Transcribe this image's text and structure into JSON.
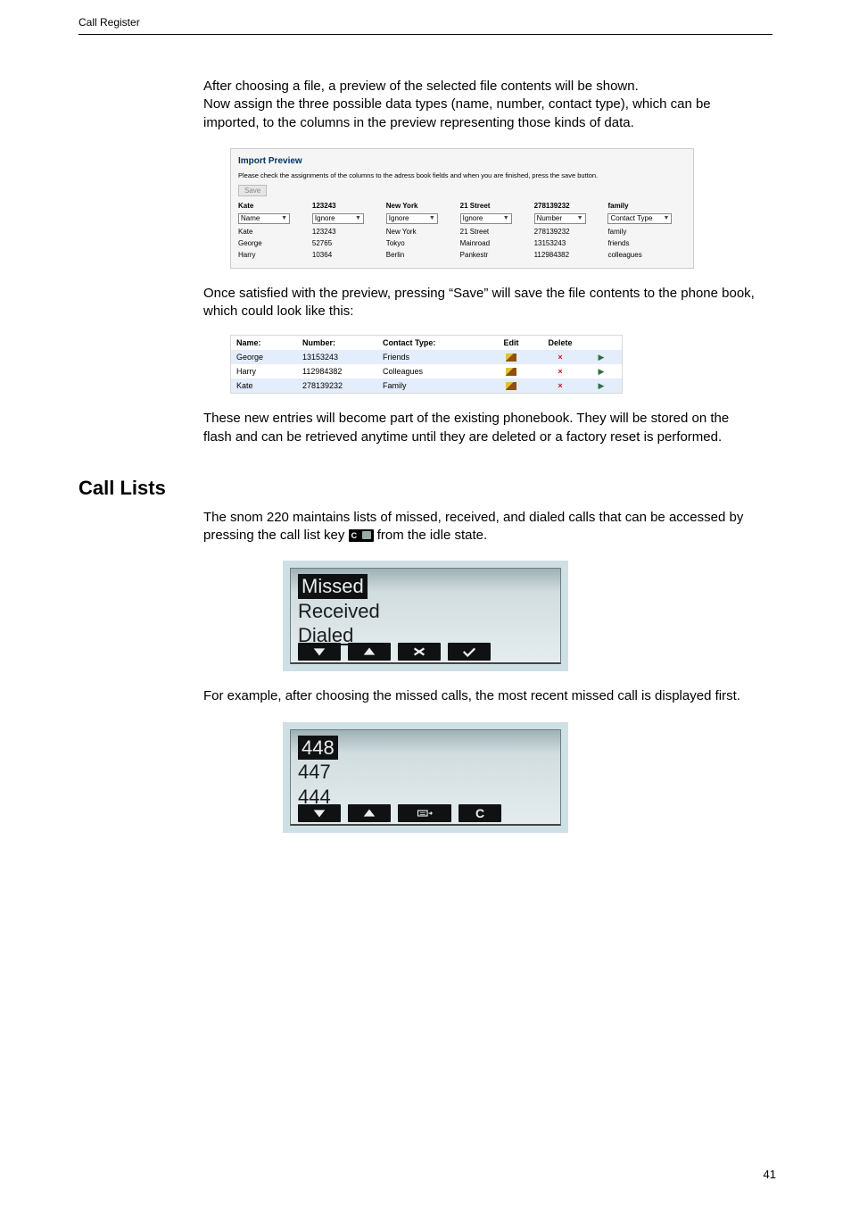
{
  "header": {
    "label": "Call Register"
  },
  "para1": "After choosing a file, a preview of the selected file contents will be shown.",
  "para2": "Now assign the three possible data types (name, number, contact type), which can be imported, to the columns in the preview representing those kinds of data.",
  "import_preview": {
    "title": "Import Preview",
    "instruction": "Please check the assignments of the columns to the adress book fields and when you are finished, press the save button.",
    "save": "Save",
    "headers": [
      "Kate",
      "123243",
      "New York",
      "21 Street",
      "278139232",
      "family"
    ],
    "selects": [
      "Name",
      "Ignore",
      "Ignore",
      "Ignore",
      "Number",
      "Contact Type"
    ],
    "rows": [
      [
        "Kate",
        "123243",
        "New York",
        "21 Street",
        "278139232",
        "family"
      ],
      [
        "George",
        "52765",
        "Tokyo",
        "Mainroad",
        "13153243",
        "friends"
      ],
      [
        "Harry",
        "10364",
        "Berlin",
        "Pankestr",
        "112984382",
        "colleagues"
      ]
    ]
  },
  "para3": "Once satisfied with the preview, pressing “Save” will save the file contents to the phone book, which could look like this:",
  "contacts": {
    "head": [
      "Name:",
      "Number:",
      "Contact Type:",
      "Edit",
      "Delete",
      ""
    ],
    "rows": [
      [
        "George",
        "13153243",
        "Friends"
      ],
      [
        "Harry",
        "112984382",
        "Colleagues"
      ],
      [
        "Kate",
        "278139232",
        "Family"
      ]
    ]
  },
  "para4": "These new entries will become part of the existing phonebook.  They will be stored on the flash and can be retrieved anytime until they are deleted or a factory reset is performed.",
  "call_lists_heading": "Call Lists",
  "para5a": "The snom 220 maintains lists of missed, received, and dialed calls that can be accessed by pressing the call list key ",
  "para5b": " from the idle state.",
  "lcd1": {
    "sel": "Missed",
    "l2": "Received",
    "l3": "Dialed"
  },
  "para6": "For example, after choosing the missed calls, the most recent missed call is displayed first.",
  "lcd2": {
    "sel": "448",
    "l2": "447",
    "l3": "444"
  },
  "page_number": "41"
}
